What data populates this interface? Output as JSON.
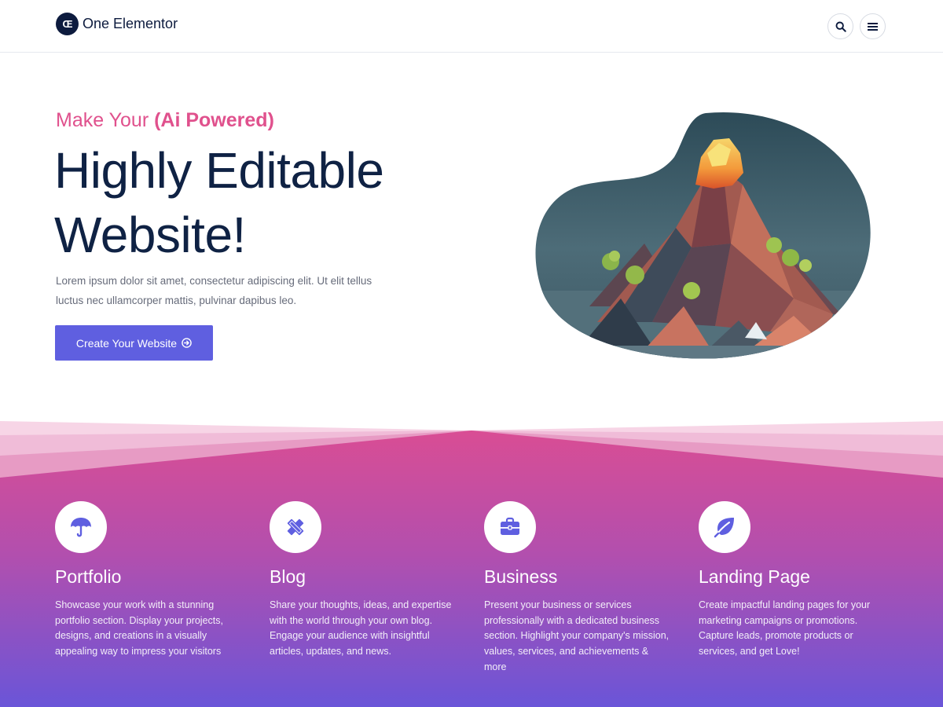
{
  "header": {
    "logo_mark": "Œ",
    "logo_text": "One Elementor",
    "search_icon": "search-icon",
    "menu_icon": "hamburger-menu-icon"
  },
  "hero": {
    "eyebrow_plain": "Make Your ",
    "eyebrow_bold": "(Ai Powered)",
    "headline_line1": "Highly Editable",
    "headline_line2": "Website!",
    "description": "Lorem ipsum dolor sit amet, consectetur adipiscing elit. Ut elit tellus luctus nec ullamcorper mattis, pulvinar dapibus leo.",
    "cta_label": "Create Your Website",
    "cta_icon": "arrow-circle-right-icon",
    "image_subject": "low-poly volcano island illustration"
  },
  "features": [
    {
      "icon": "umbrella-icon",
      "title": "Portfolio",
      "description": "Showcase your work with a stunning portfolio section. Display your projects, designs, and creations in a visually appealing way to impress your visitors"
    },
    {
      "icon": "pencil-ruler-icon",
      "title": "Blog",
      "description": "Share your thoughts, ideas, and expertise with the world through your own blog. Engage your audience with insightful articles, updates, and news."
    },
    {
      "icon": "briefcase-icon",
      "title": "Business",
      "description": "Present your business or services professionally with a dedicated business section. Highlight your company's mission, values, services, and achievements & more"
    },
    {
      "icon": "leaf-icon",
      "title": "Landing Page",
      "description": "Create impactful landing pages for your marketing campaigns or promotions. Capture leads, promote products or services, and get Love!"
    }
  ],
  "colors": {
    "navy": "#0f2244",
    "pink": "#e0518d",
    "purple_button": "#5f5fe0",
    "gradient_top": "#d94d94",
    "gradient_bottom": "#6a55d8"
  }
}
